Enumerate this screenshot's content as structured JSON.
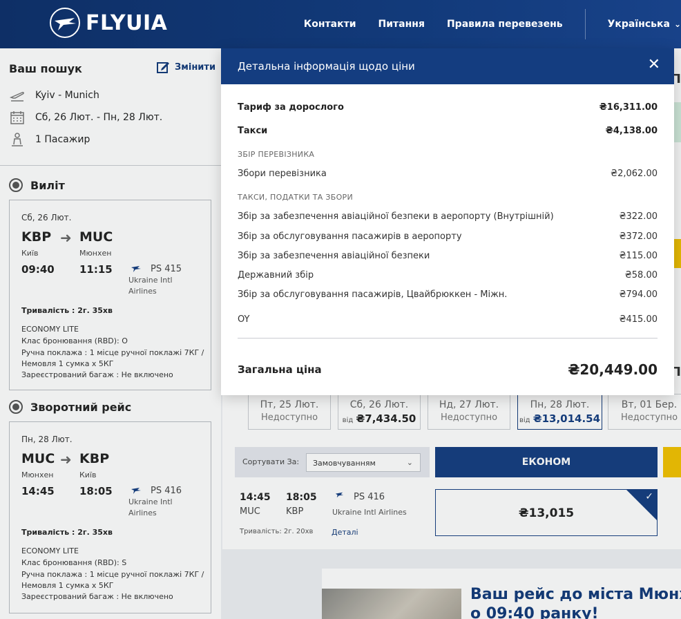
{
  "header": {
    "logo_text": "FLYUIA",
    "nav": [
      "Контакти",
      "Питання",
      "Правила перевезень"
    ],
    "language": "Українська"
  },
  "search": {
    "title": "Ваш пошук",
    "edit_label": "Змінити",
    "route": "Kyiv - Munich",
    "dates": "Сб, 26 Лют. - Пн, 28 Лют.",
    "passengers": "1 Пасажир"
  },
  "outbound": {
    "heading": "Виліт",
    "date": "Сб, 26 Лют.",
    "from_code": "KBP",
    "to_code": "MUC",
    "from_city": "Київ",
    "to_city": "Мюнхен",
    "dep_time": "09:40",
    "arr_time": "11:15",
    "flight": "PS  415",
    "carrier": "Ukraine Intl Airlines",
    "duration": "Тривалість : 2г. 35хв",
    "fare": "ECONOMY LITE",
    "rbd": "Клас бронювання (RBD):  O",
    "hand_bag_1": "Ручна поклажа : 1 місце ручної поклажі 7КГ /",
    "hand_bag_2": "Немовля 1 сумка x 5КГ",
    "checked_bag": "Зареєстрований багаж : Не включено"
  },
  "inbound": {
    "heading": "Зворотний рейс",
    "date": "Пн, 28 Лют.",
    "from_code": "MUC",
    "to_code": "KBP",
    "from_city": "Мюнхен",
    "to_city": "Київ",
    "dep_time": "14:45",
    "arr_time": "18:05",
    "flight": "PS  416",
    "carrier": "Ukraine Intl Airlines",
    "duration": "Тривалість : 2г. 35хв",
    "fare": "ECONOMY LITE",
    "rbd": "Клас бронювання (RBD):  S",
    "hand_bag_1": "Ручна поклажа : 1 місце ручної поклажі 7КГ /",
    "hand_bag_2": "Немовля 1 сумка x 5КГ",
    "checked_bag": "Зареєстрований багаж : Не включено"
  },
  "date_tabs": [
    {
      "date": "Пт, 25 Лют.",
      "status": "Недоступно"
    },
    {
      "date": "Сб, 26 Лют.",
      "from": "від",
      "price": "₴7,434.50"
    },
    {
      "date": "Нд, 27 Лют.",
      "status": "Недоступно"
    },
    {
      "date": "Пн, 28 Лют.",
      "from": "від",
      "price": "₴13,014.54"
    },
    {
      "date": "Вт, 01 Бер.",
      "status": "Недоступно"
    }
  ],
  "sort": {
    "label": "Сортувати За:",
    "value": "Замовчуванням"
  },
  "economy_label": "ЕКОНОМ",
  "result": {
    "dep_time": "14:45",
    "arr_time": "18:05",
    "dep_code": "MUC",
    "arr_code": "KBP",
    "flight": "PS  416",
    "carrier": "Ukraine Intl Airlines",
    "duration": "Тривалість: 2г. 20хв",
    "details": "Деталі",
    "price": "₴13,015"
  },
  "promo": {
    "line1": "Ваш рейс до міста Мюнх",
    "line2": "о 09:40 ранку!"
  },
  "modal": {
    "title": "Детальна інформація щодо ціни",
    "adult_fare_label": "Тариф за дорослого",
    "adult_fare_amount": "₴16,311.00",
    "taxes_label": "Такси",
    "taxes_amount": "₴4,138.00",
    "carrier_section": "ЗБІР ПЕРЕВІЗНИКА",
    "carrier_fees_label": "Збори перевізника",
    "carrier_fees_amount": "₴2,062.00",
    "taxes_section": "ТАКСИ, ПОДАТКИ ТА ЗБОРИ",
    "items": [
      {
        "label": "Збір за забезпечення авіаційної безпеки в аеропорту (Внутрішній)",
        "amount": "₴322.00"
      },
      {
        "label": "Збір за обслуговування пасажирів в аеропорту",
        "amount": "₴372.00"
      },
      {
        "label": "Збір за забезпечення авіаційної безпеки",
        "amount": "₴115.00"
      },
      {
        "label": "Державний збір",
        "amount": "₴58.00"
      },
      {
        "label": "Збір за обслуговування пасажирів, Цвайбрюккен - Міжн.",
        "amount": "₴794.00"
      }
    ],
    "oy_label": "OY",
    "oy_amount": "₴415.00",
    "total_label": "Загальна ціна",
    "total_amount": "₴20,449.00"
  },
  "colors": {
    "brand_blue": "#143d80",
    "accent_yellow": "#f2c200"
  }
}
